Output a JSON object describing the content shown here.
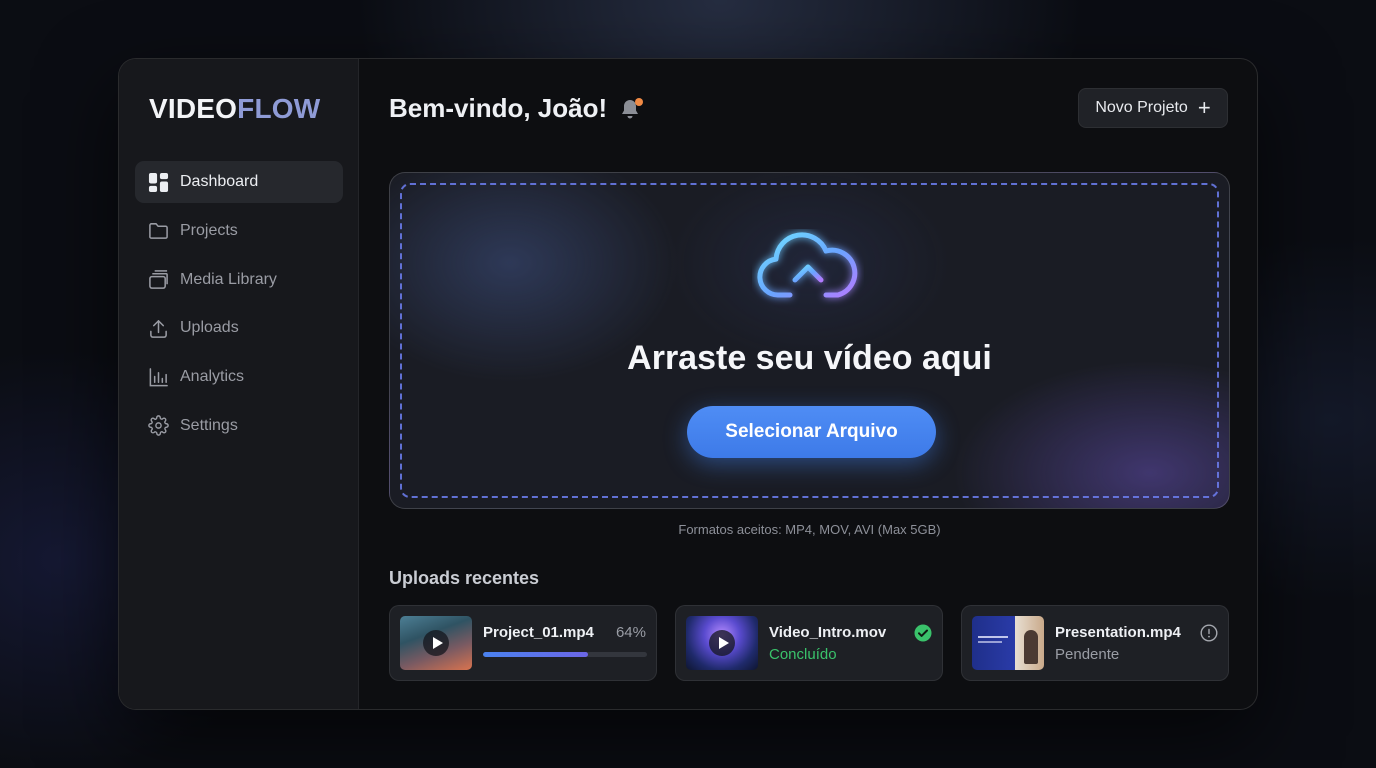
{
  "app": {
    "logo_part1": "VIDEO",
    "logo_part2": "FLOW"
  },
  "sidebar": {
    "items": [
      {
        "label": "Dashboard",
        "icon": "dashboard-icon",
        "active": true
      },
      {
        "label": "Projects",
        "icon": "folder-icon",
        "active": false
      },
      {
        "label": "Media Library",
        "icon": "media-library-icon",
        "active": false
      },
      {
        "label": "Uploads",
        "icon": "upload-icon",
        "active": false
      },
      {
        "label": "Analytics",
        "icon": "analytics-icon",
        "active": false
      },
      {
        "label": "Settings",
        "icon": "gear-icon",
        "active": false
      }
    ]
  },
  "header": {
    "welcome": "Bem-vindo, João!",
    "new_project_label": "Novo Projeto",
    "notification_icon": "bell-icon"
  },
  "upload": {
    "title": "Arraste seu vídeo aqui",
    "button_label": "Selecionar Arquivo",
    "formats": "Formatos aceitos: MP4, MOV, AVI (Max 5GB)",
    "icon": "cloud-upload-icon"
  },
  "recent": {
    "title": "Uploads recentes",
    "items": [
      {
        "name": "Project_01.mp4",
        "progress_text": "64%",
        "progress": 0.64
      },
      {
        "name": "Video_Intro.mov",
        "status": "Concluído",
        "status_color": "#3ac26b"
      },
      {
        "name": "Presentation.mp4",
        "status": "Pendente",
        "status_color": "#9a9da5"
      }
    ]
  },
  "colors": {
    "accent": "#4a86f2",
    "logo_accent": "#8f9bd6",
    "success": "#3ac26b",
    "notification_dot": "#f08a45"
  }
}
